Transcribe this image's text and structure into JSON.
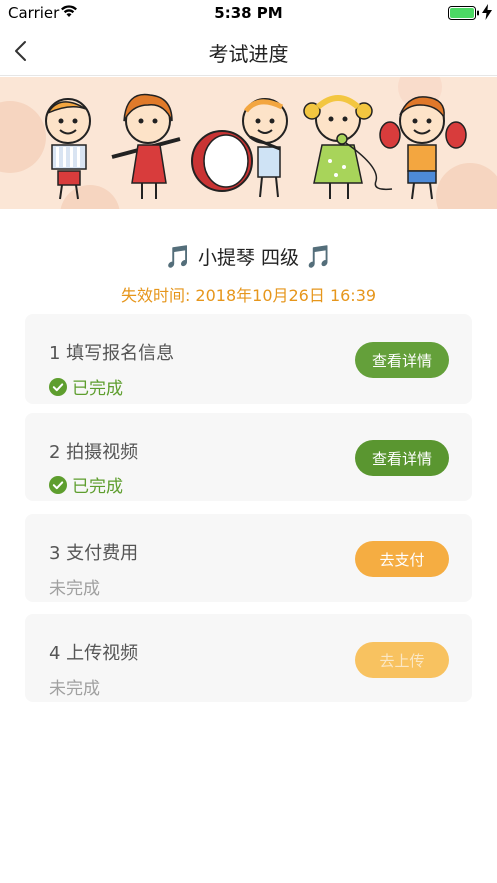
{
  "status_bar": {
    "carrier": "Carrier",
    "time": "5:38 PM"
  },
  "nav": {
    "title": "考试进度",
    "back_icon": "chevron-left-icon"
  },
  "banner": {
    "image": "children-playing-instruments-illustration"
  },
  "exam": {
    "note_left": "🎵",
    "name": "小提琴 四级",
    "note_right": "🎵",
    "expiry": "失效时间: 2018年10月26日 16:39"
  },
  "colors": {
    "accent_orange": "#e6961c",
    "done_green": "#5e9e2e",
    "button_green": "#64a03a",
    "button_orange": "#f5ad42"
  },
  "steps": [
    {
      "title": "1 填写报名信息",
      "status": "已完成",
      "button": "查看详情"
    },
    {
      "title": "2 拍摄视频",
      "status": "已完成",
      "button": "查看详情"
    },
    {
      "title": "3 支付费用",
      "status": "未完成",
      "button": "去支付"
    },
    {
      "title": "4 上传视频",
      "status": "未完成",
      "button": "去上传"
    }
  ]
}
